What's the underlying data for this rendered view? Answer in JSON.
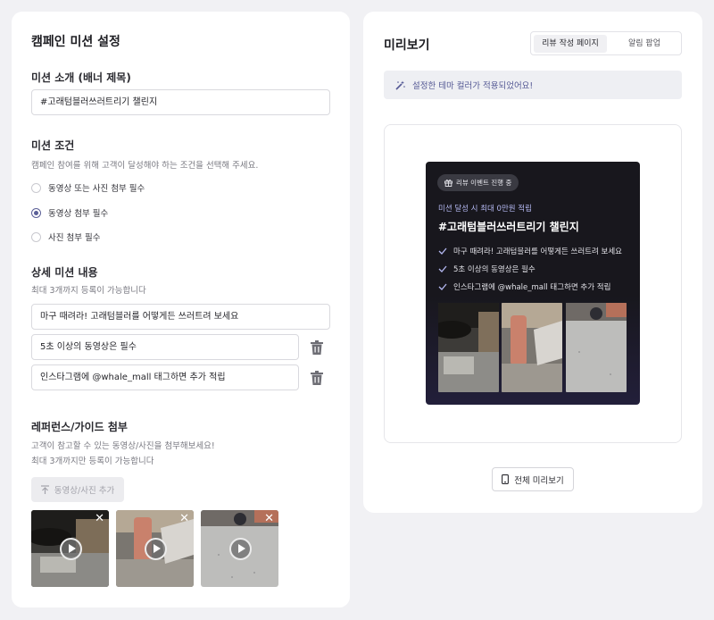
{
  "left": {
    "title": "캠페인 미션 설정",
    "banner_section_label": "미션 소개 (배너 제목)",
    "banner_title_value": "#고래텀블러쓰러트리기 챌린지",
    "condition_section_label": "미션 조건",
    "condition_help": "캠페인 참여를 위해 고객이 달성해야 하는 조건을 선택해 주세요.",
    "condition_options": [
      {
        "label": "동영상 또는 사진 첨부 필수",
        "selected": false
      },
      {
        "label": "동영상 첨부 필수",
        "selected": true
      },
      {
        "label": "사진 첨부 필수",
        "selected": false
      }
    ],
    "detail_section_label": "상세 미션 내용",
    "detail_help": "최대 3개까지 등록이 가능합니다",
    "detail_items": [
      "마구 때려라! 고래텀블러를 어떻게든 쓰러트려 보세요",
      "5초 이상의 동영상은 필수",
      "인스타그램에 @whale_mall 태그하면 추가 적립"
    ],
    "reference_section_label": "레퍼런스/가이드 첨부",
    "reference_help_1": "고객이 참고할 수 있는 동영상/사진을 첨부해보세요!",
    "reference_help_2": "최대 3개까지만 등록이 가능합니다",
    "upload_button_label": "동영상/사진 추가",
    "remove_glyph": "✕"
  },
  "right": {
    "title": "미리보기",
    "tabs": [
      {
        "label": "리뷰 작성 페이지",
        "active": true
      },
      {
        "label": "알림 팝업",
        "active": false
      }
    ],
    "notice": "설정한 테마 컬러가 적용되었어요!",
    "card": {
      "badge": "리뷰 이벤트 진행 중",
      "subtitle": "미션 달성 시 최대 0만원 적립",
      "title": "#고래텀블러쓰러트리기 챌린지",
      "items": [
        "마구 때려라! 고래텀블러를 어떻게든 쓰러트려 보세요",
        "5초 이상의 동영상은 필수",
        "인스타그램에 @whale_mall 태그하면 추가 적립"
      ]
    },
    "full_preview_label": "전체 미리보기"
  },
  "colors": {
    "accent": "#5b5f97",
    "notice_text": "#545894",
    "card_subtitle": "#b3b7f0",
    "card_bg": "#18171d"
  },
  "icons": [
    "trash-icon",
    "upload-icon",
    "magic-wand-icon",
    "gift-icon",
    "check-icon",
    "play-icon",
    "close-icon",
    "mobile-icon"
  ]
}
